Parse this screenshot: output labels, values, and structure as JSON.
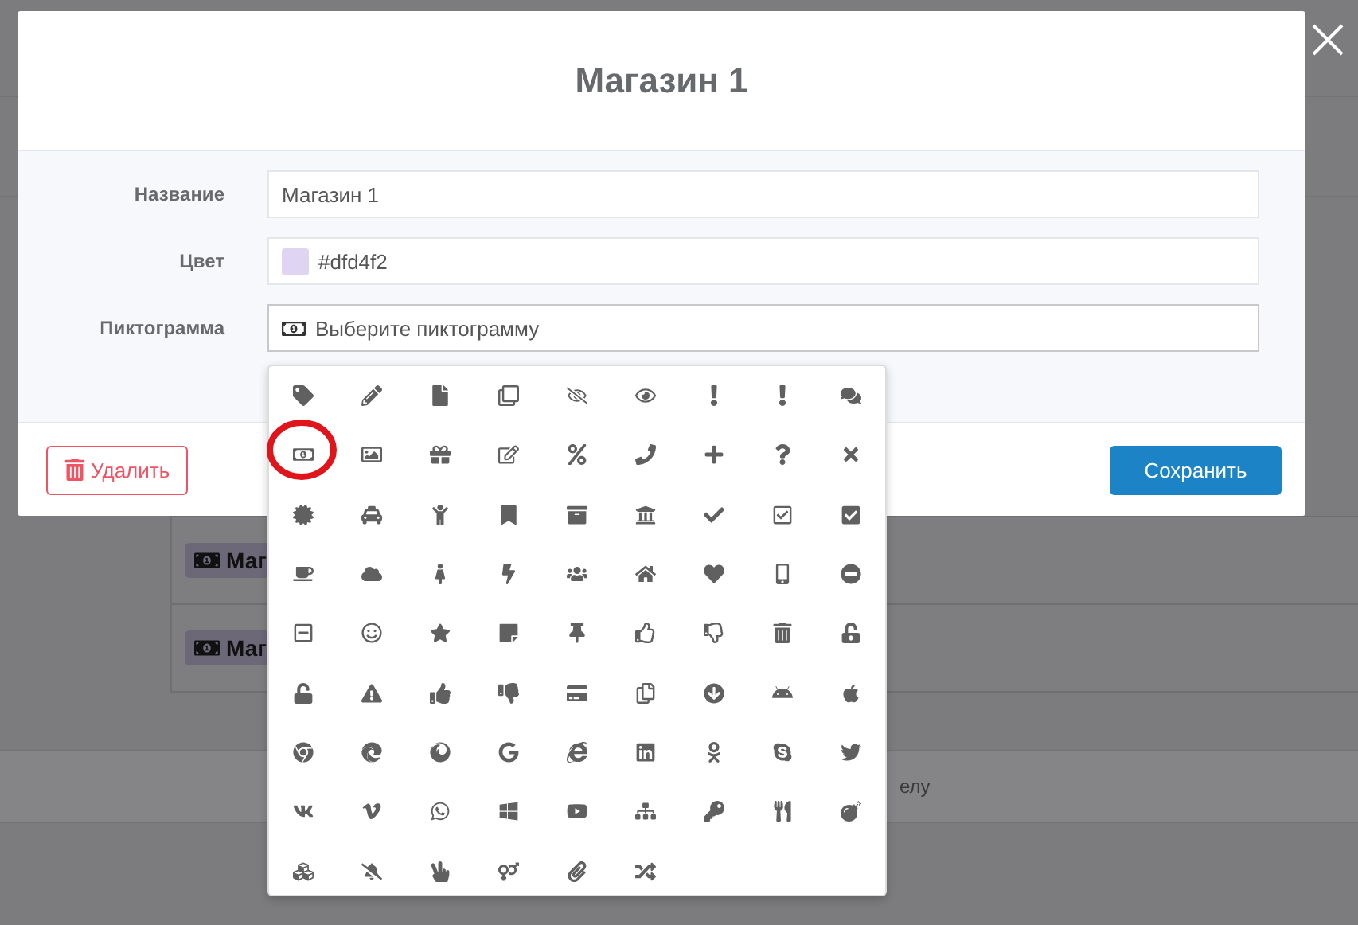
{
  "background": {
    "badges": [
      "Маг",
      "Маг"
    ],
    "footer_text": "елу"
  },
  "modal": {
    "title": "Магазин 1",
    "fields": [
      {
        "kind": "text",
        "label": "Название",
        "value": "Магазин 1"
      },
      {
        "kind": "color",
        "label": "Цвет",
        "value": "#dfd4f2",
        "color": "#dfd4f2"
      },
      {
        "kind": "icon",
        "label": "Пиктограмма",
        "value": "Выберите пиктограмму"
      }
    ],
    "delete_button": "Удалить",
    "save_button": "Сохранить"
  },
  "icon_picker": {
    "open": true,
    "annotated": true
  }
}
